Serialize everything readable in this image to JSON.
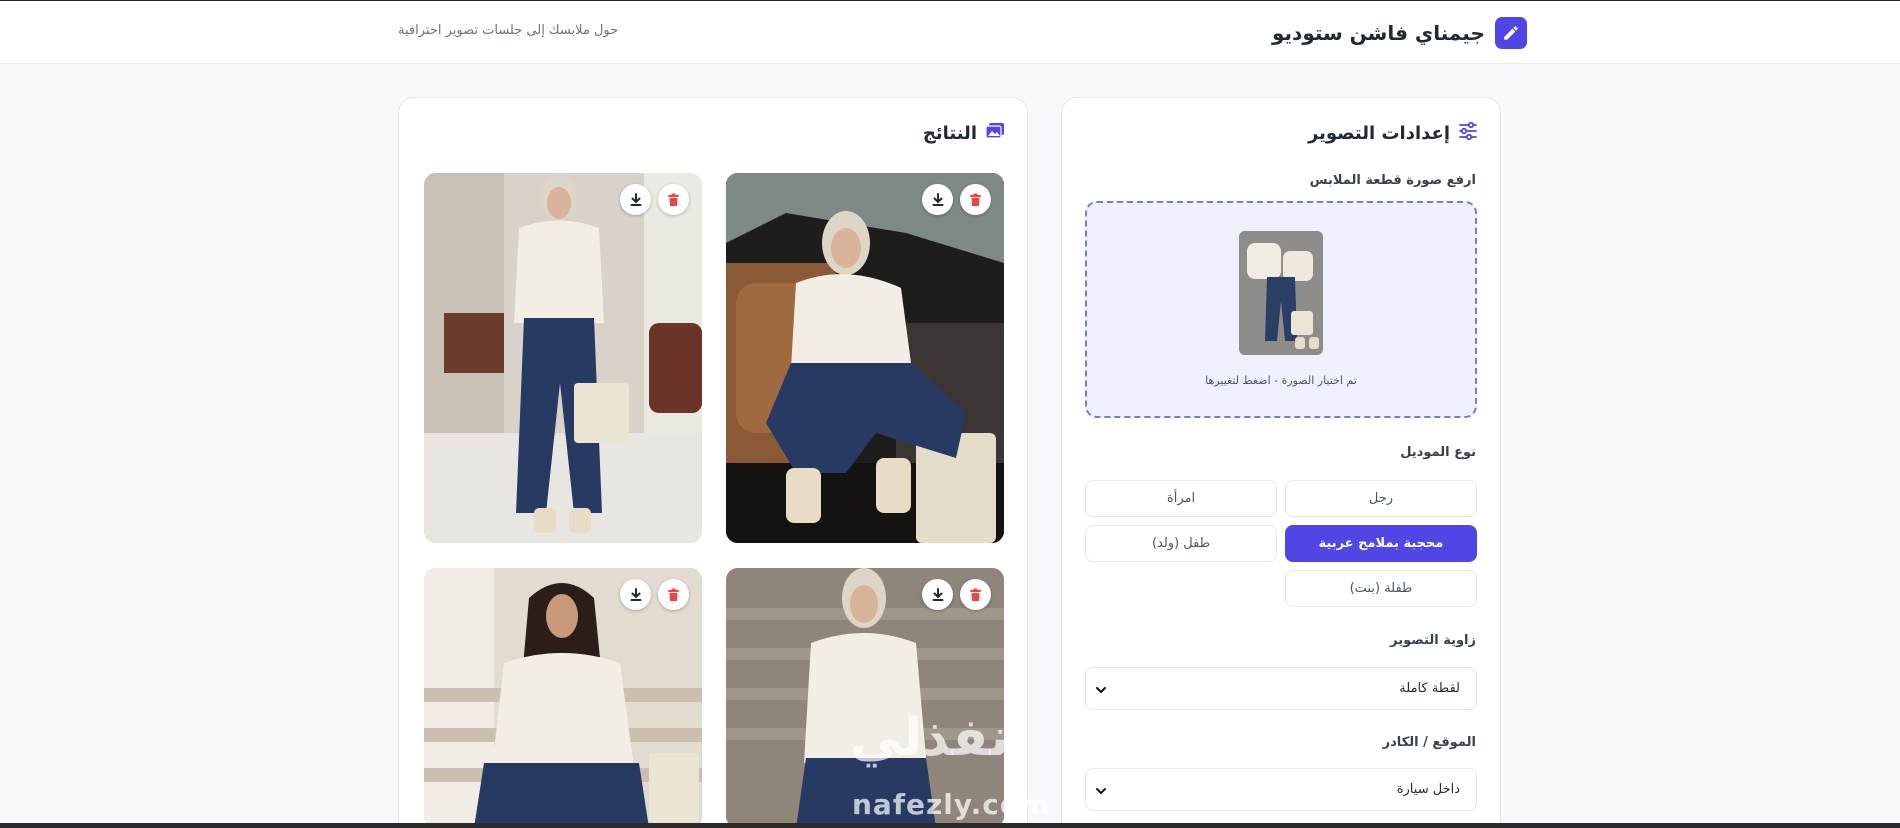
{
  "header": {
    "app_title": "جيمناي فاشن ستوديو",
    "tagline": "حول ملابسك إلى جلسات تصوير احترافية"
  },
  "settings": {
    "title": "إعدادات التصوير",
    "upload_label": "ارفع صورة قطعة الملابس",
    "upload_caption": "تم اختيار الصورة - اضغط لتغييرها",
    "model_type_label": "نوع الموديل",
    "model_options": [
      {
        "label": "رجل",
        "selected": false
      },
      {
        "label": "امرأة",
        "selected": false
      },
      {
        "label": "محجبة بملامح عربية",
        "selected": true
      },
      {
        "label": "طفل (ولد)",
        "selected": false
      },
      {
        "label": "طفلة (بنت)",
        "selected": false
      }
    ],
    "angle_label": "زاوية التصوير",
    "angle_value": "لقطة كاملة",
    "location_label": "الموقع / الكادر",
    "location_value": "داخل سيارة"
  },
  "results": {
    "title": "النتائج",
    "cards": [
      {
        "scene": "car-interior"
      },
      {
        "scene": "living-room"
      },
      {
        "scene": "stairs-hijab"
      },
      {
        "scene": "stairs-hair"
      }
    ]
  },
  "watermark": {
    "arabic": "نفذلي",
    "latin": "nafezly.com"
  },
  "colors": {
    "accent": "#4f46e5",
    "upload_bg": "#eef0fe",
    "delete_icon": "#ef4444"
  }
}
